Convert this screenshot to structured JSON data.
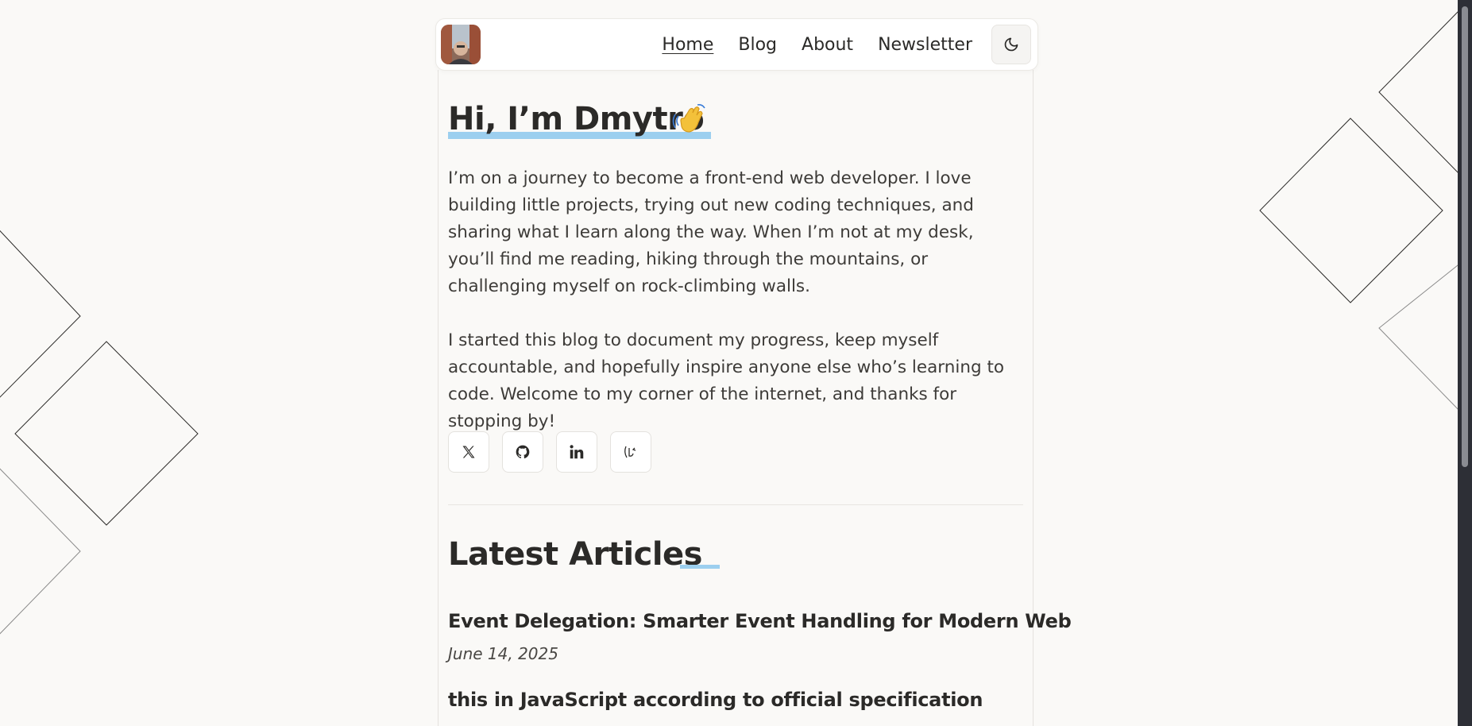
{
  "nav": {
    "links": [
      {
        "label": "Home",
        "active": true
      },
      {
        "label": "Blog",
        "active": false
      },
      {
        "label": "About",
        "active": false
      },
      {
        "label": "Newsletter",
        "active": false
      }
    ],
    "theme_icon": "moon-icon"
  },
  "hero": {
    "title": "Hi, I’m Dmytro",
    "emoji_icon": "waving-hand-icon",
    "paragraphs": [
      "I’m on a journey to become a front-end web developer. I love building little projects, trying out new coding techniques, and sharing what I learn along the way. When I’m not at my desk, you’ll find me reading, hiking through the mountains, or challenging myself on rock-climbing walls.",
      "I started this blog to document my progress, keep myself accountable, and hopefully inspire anyone else who’s learning to code. Welcome to my corner of the internet, and thanks for stopping by!"
    ]
  },
  "socials": [
    "x-icon",
    "github-icon",
    "linkedin-icon",
    "dev-icon"
  ],
  "latest": {
    "title": "Latest Articles",
    "articles": [
      {
        "title": "Event Delegation: Smarter Event Handling for Modern Web",
        "date": "June 14, 2025"
      },
      {
        "title": "this in JavaScript according to official specification",
        "date": ""
      }
    ]
  },
  "colors": {
    "background": "#faf9f7",
    "accent": "#9ccfef",
    "text": "#2b2a28"
  }
}
